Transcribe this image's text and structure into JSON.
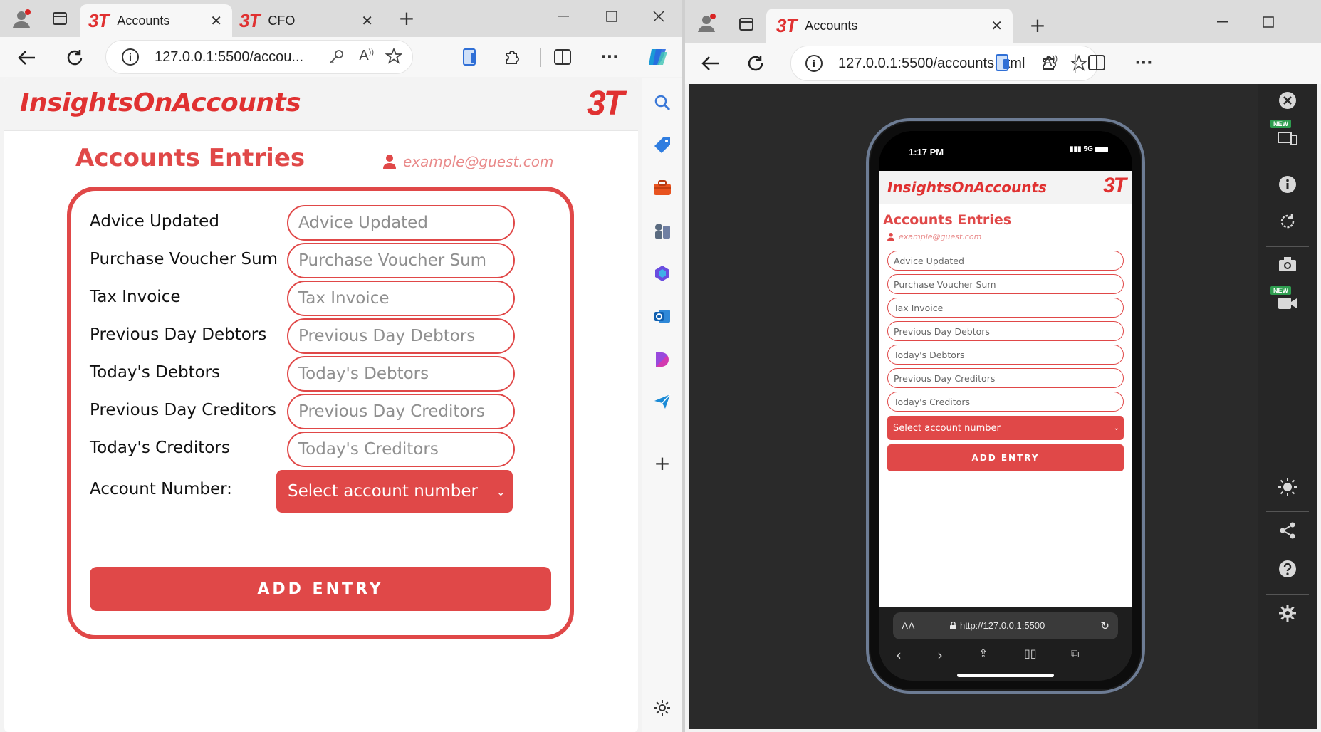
{
  "left_browser": {
    "tabs": [
      {
        "logo": "3T",
        "title": "Accounts",
        "close": "✕"
      },
      {
        "logo": "3T",
        "title": "CFO",
        "close": "✕"
      }
    ],
    "new_tab": "+",
    "url": "127.0.0.1:5500/accou...",
    "sidebar_icons": [
      "search-icon",
      "tag-icon",
      "toolbox-icon",
      "chess-icon",
      "copilot-icon",
      "outlook-icon",
      "designer-icon",
      "send-icon",
      "add-icon",
      "gear-icon"
    ],
    "sidebar_add": "+"
  },
  "app": {
    "brand": "InsightsOnAccounts",
    "brand_logo": "3T",
    "page_title": "Accounts Entries",
    "user_email": "example@guest.com",
    "fields": [
      {
        "label": "Advice Updated",
        "placeholder": "Advice Updated"
      },
      {
        "label": "Purchase Voucher Sum",
        "placeholder": "Purchase Voucher Sum"
      },
      {
        "label": "Tax Invoice",
        "placeholder": "Tax Invoice"
      },
      {
        "label": "Previous Day Debtors",
        "placeholder": "Previous Day Debtors"
      },
      {
        "label": "Today's Debtors",
        "placeholder": "Today's Debtors"
      },
      {
        "label": "Previous Day Creditors",
        "placeholder": "Previous Day Creditors"
      },
      {
        "label": "Today's Creditors",
        "placeholder": "Today's Creditors"
      }
    ],
    "account_number_label": "Account Number:",
    "account_select_value": "Select account number",
    "add_button": "ADD ENTRY",
    "accent_color": "#e04848"
  },
  "right_browser": {
    "tab_logo": "3T",
    "tab_title": "Accounts",
    "tab_close": "✕",
    "new_tab": "+",
    "url": "127.0.0.1:5500/accounts.html",
    "phone": {
      "time": "1:17 PM",
      "network": "5G",
      "url": "http://127.0.0.1:5500",
      "text_size": "AA"
    },
    "rail_badges": [
      "NEW",
      "NEW"
    ]
  }
}
